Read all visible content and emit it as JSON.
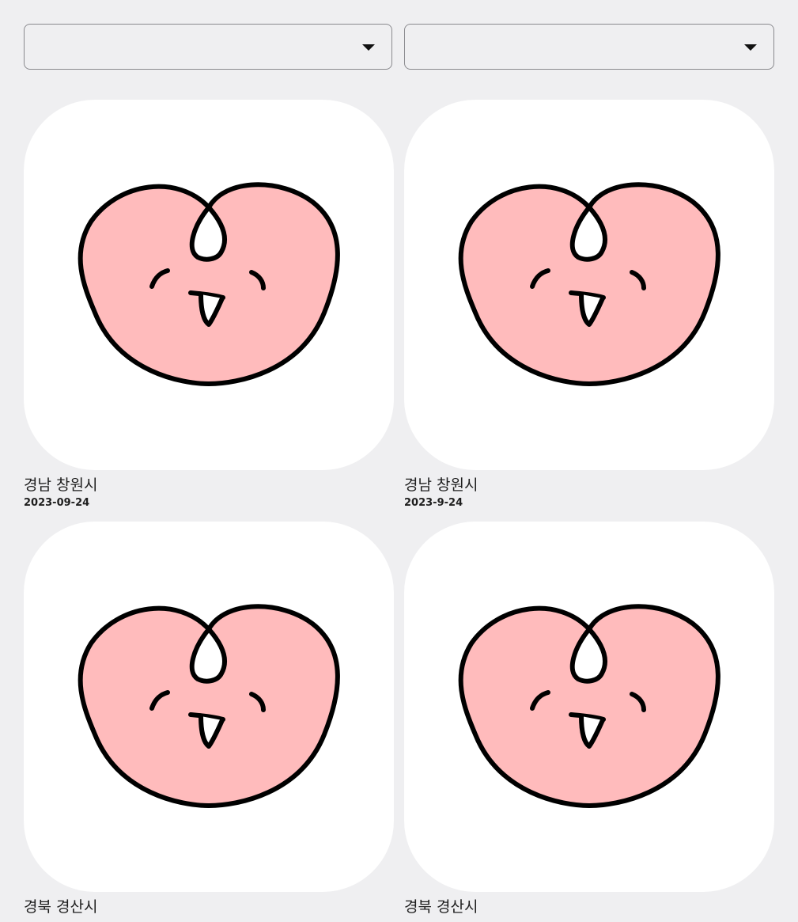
{
  "filters": {
    "region": {
      "value": "",
      "icon": "caret-down-icon"
    },
    "sort": {
      "value": "",
      "icon": "caret-down-icon"
    }
  },
  "items": [
    {
      "location": "경남 창원시",
      "date": "2023-09-24",
      "thumbnail": "peach-face-logo"
    },
    {
      "location": "경남 창원시",
      "date": "2023-9-24",
      "thumbnail": "peach-face-logo"
    },
    {
      "location": "경북 경산시",
      "date": "",
      "thumbnail": "peach-face-logo"
    },
    {
      "location": "경북 경산시",
      "date": "",
      "thumbnail": "peach-face-logo"
    }
  ],
  "colors": {
    "background": "#efeff1",
    "card": "#ffffff",
    "peach": "#ffbbbc",
    "outline": "#000000"
  }
}
